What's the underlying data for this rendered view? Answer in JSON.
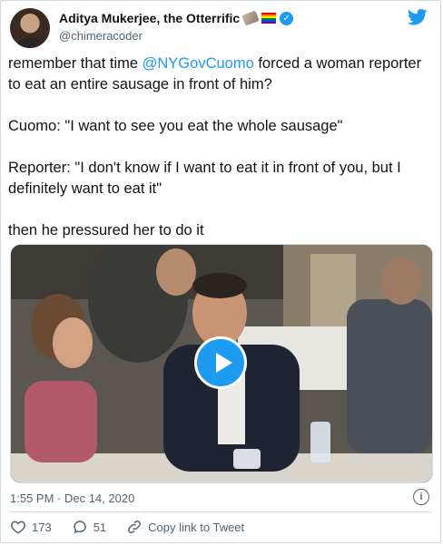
{
  "author": {
    "display_name": "Aditya Mukerjee, the Otterrific",
    "handle": "@chimeracoder",
    "verified_mark": "✓",
    "name_emojis": [
      "feather-emoji",
      "rainbow-flag-emoji"
    ],
    "avatar_icon": "user-avatar"
  },
  "tweet": {
    "line1_before": "remember that time ",
    "mention": "@NYGovCuomo",
    "line1_after": " forced a woman reporter to eat an entire sausage in front of him?",
    "paragraph2": "Cuomo: \"I want to see you eat the whole sausage\"",
    "paragraph3": "Reporter: \"I don't know if I want to eat it in front of you, but I definitely want to eat it\"",
    "paragraph4": "then he pressured her to do it"
  },
  "media": {
    "kind": "video",
    "play_icon": "play-icon"
  },
  "meta": {
    "timestamp": "1:55 PM · Dec 14, 2020",
    "info_icon_glyph": "i"
  },
  "actions": {
    "likes": "173",
    "replies": "51",
    "copy_link_label": "Copy link to Tweet"
  },
  "colors": {
    "accent": "#1d9bf0",
    "text": "#0f1419",
    "muted": "#536471",
    "border": "#cfd9de"
  }
}
